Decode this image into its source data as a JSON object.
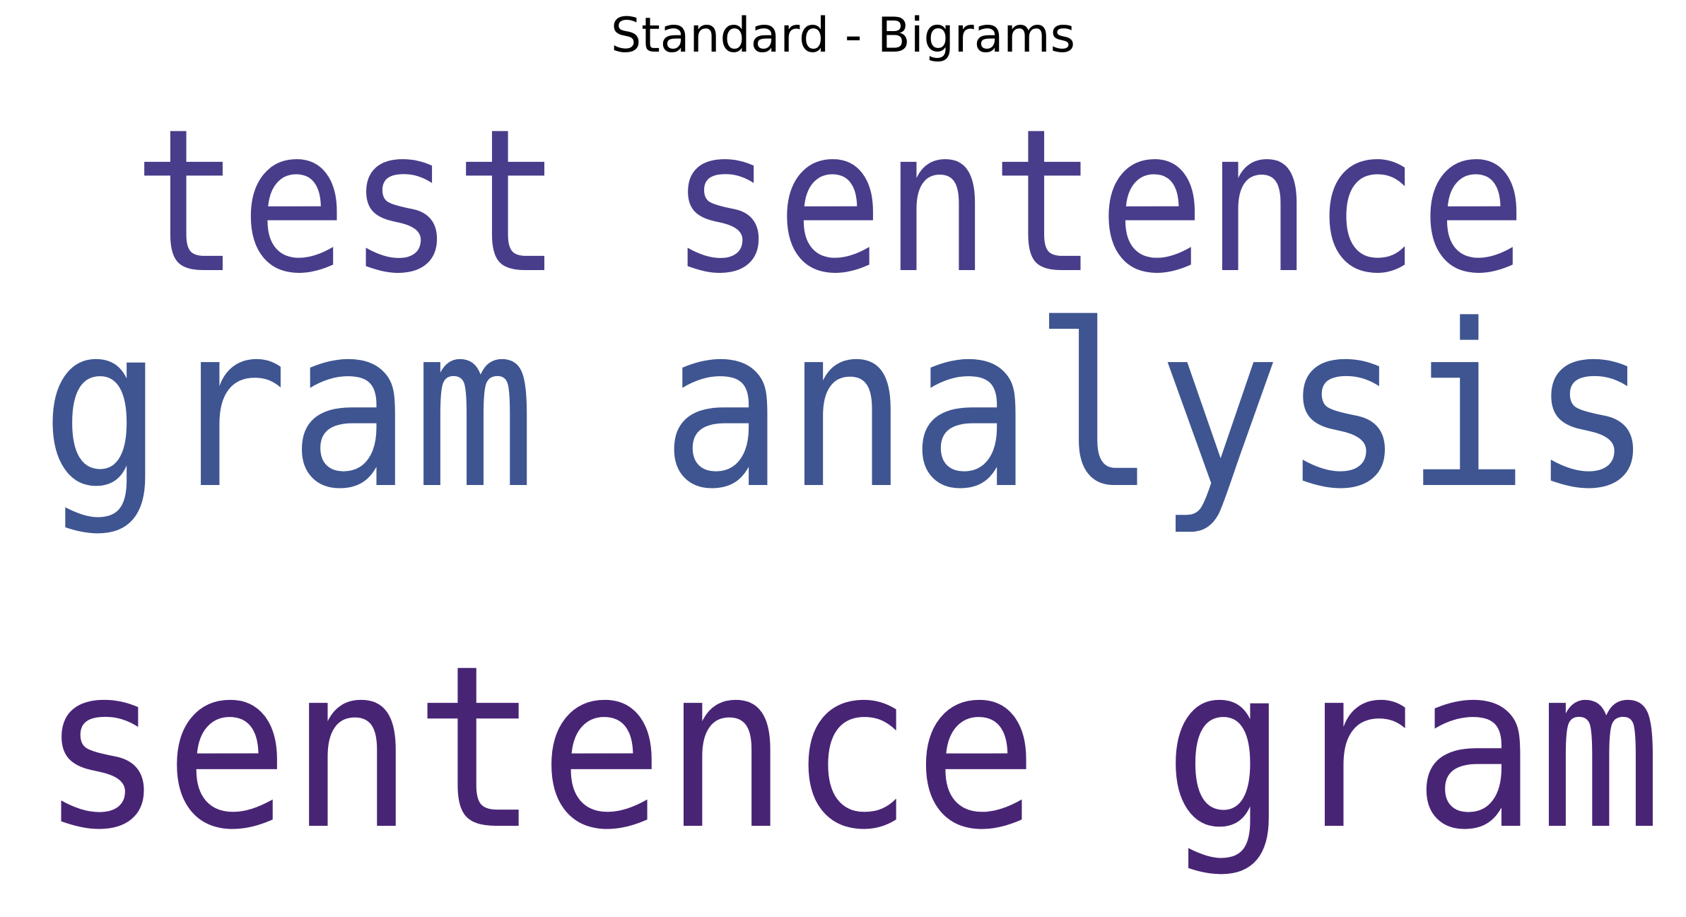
{
  "chart_data": {
    "type": "wordcloud",
    "title": "Standard - Bigrams",
    "words": [
      {
        "text": "test sentence",
        "color": "#483d8b"
      },
      {
        "text": "gram analysis",
        "color": "#3e5591"
      },
      {
        "text": "sentence gram",
        "color": "#482475"
      }
    ]
  }
}
